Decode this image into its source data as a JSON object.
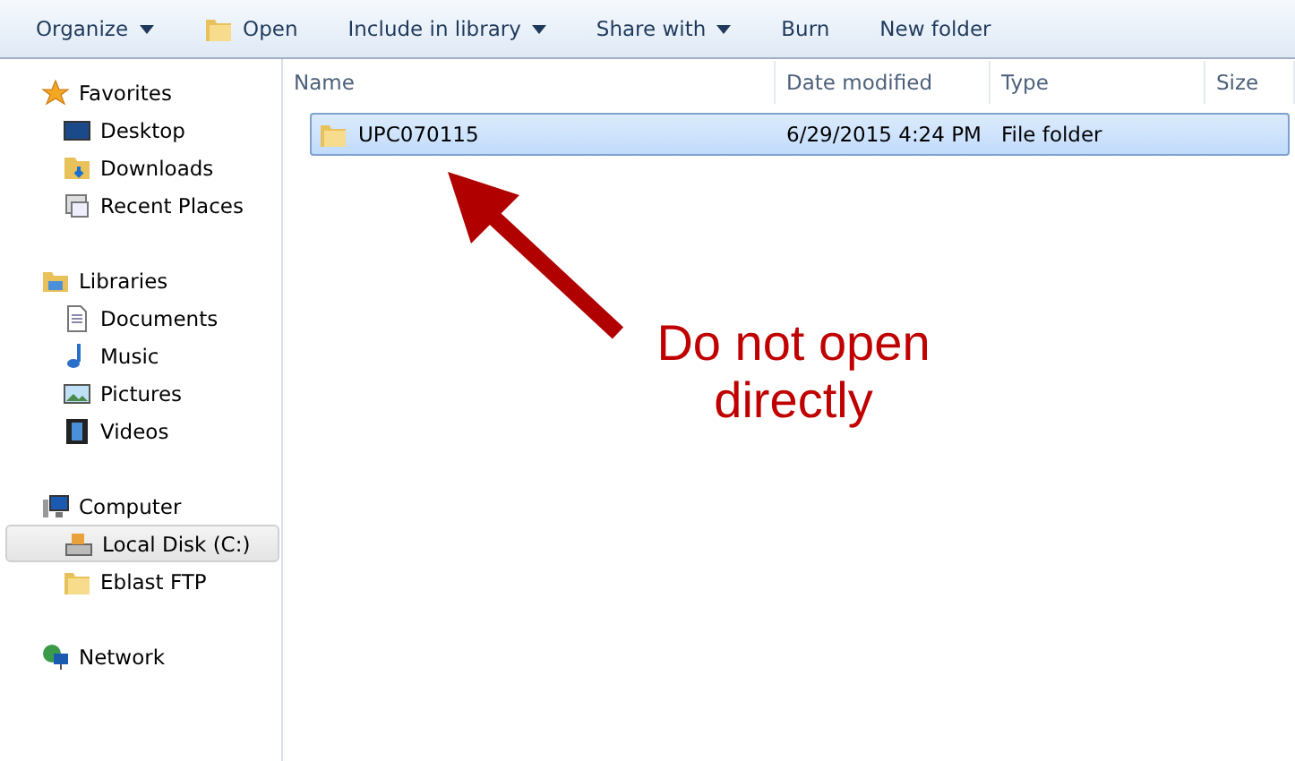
{
  "toolbar": [
    {
      "label": "Organize",
      "kind": "menu"
    },
    {
      "label": "Open",
      "kind": "open"
    },
    {
      "label": "Include in library",
      "kind": "menu"
    },
    {
      "label": "Share with",
      "kind": "menu"
    },
    {
      "label": "Burn",
      "kind": "plain"
    },
    {
      "label": "New folder",
      "kind": "plain"
    }
  ],
  "sidebar": {
    "groups": [
      {
        "label": "Favorites",
        "kind": "star",
        "children": [
          {
            "label": "Desktop",
            "kind": "desktop",
            "selected": false
          },
          {
            "label": "Downloads",
            "kind": "downloads",
            "selected": false
          },
          {
            "label": "Recent Places",
            "kind": "recent",
            "selected": false
          }
        ]
      },
      {
        "label": "Libraries",
        "kind": "library",
        "children": [
          {
            "label": "Documents",
            "kind": "document",
            "selected": false
          },
          {
            "label": "Music",
            "kind": "music",
            "selected": false
          },
          {
            "label": "Pictures",
            "kind": "pictures",
            "selected": false
          },
          {
            "label": "Videos",
            "kind": "videos",
            "selected": false
          }
        ]
      },
      {
        "label": "Computer",
        "kind": "computer",
        "children": [
          {
            "label": "Local Disk (C:)",
            "kind": "disk",
            "selected": true
          },
          {
            "label": "Eblast FTP",
            "kind": "folder",
            "selected": false
          }
        ]
      },
      {
        "label": "Network",
        "kind": "network"
      }
    ]
  },
  "table": {
    "columns": [
      "Name",
      "Date modified",
      "Type",
      "Size"
    ],
    "rows": [
      {
        "name": "UPC070115",
        "date": "6/29/2015 4:24 PM",
        "type": "File folder",
        "selected": true
      }
    ]
  },
  "annotation": {
    "text": "Do not open directly"
  }
}
